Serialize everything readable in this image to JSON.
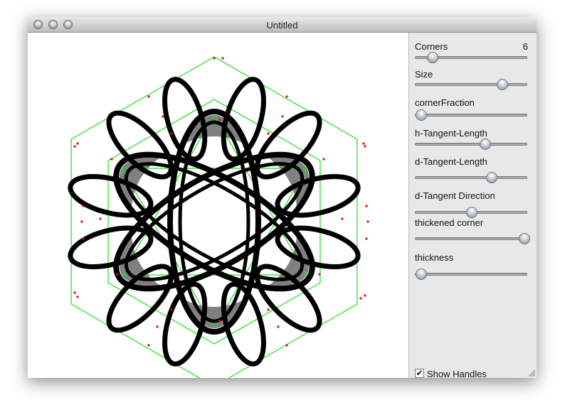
{
  "window": {
    "title": "Untitled"
  },
  "controls": {
    "corners": {
      "label": "Corners",
      "value": "6",
      "level": 0.15
    },
    "size": {
      "label": "Size",
      "level": 0.77
    },
    "corner_fraction": {
      "label": "cornerFraction",
      "level": 0.05
    },
    "h_tangent_length": {
      "label": "h-Tangent-Length",
      "level": 0.62
    },
    "d_tangent_length": {
      "label": "d-Tangent-Length",
      "level": 0.68
    },
    "d_tangent_direction": {
      "label": "d-Tangent Direction",
      "level": 0.5
    },
    "thickened_corner": {
      "label": "thickened corner",
      "level": 0.97
    },
    "thickness": {
      "label": "thickness",
      "level": 0.05
    },
    "show_handles": {
      "label": "Show Handles",
      "checked": true
    }
  },
  "colors": {
    "guide": "#22dd22",
    "handle": "#dd1111",
    "curve": "#000000",
    "fill": "#808080"
  }
}
